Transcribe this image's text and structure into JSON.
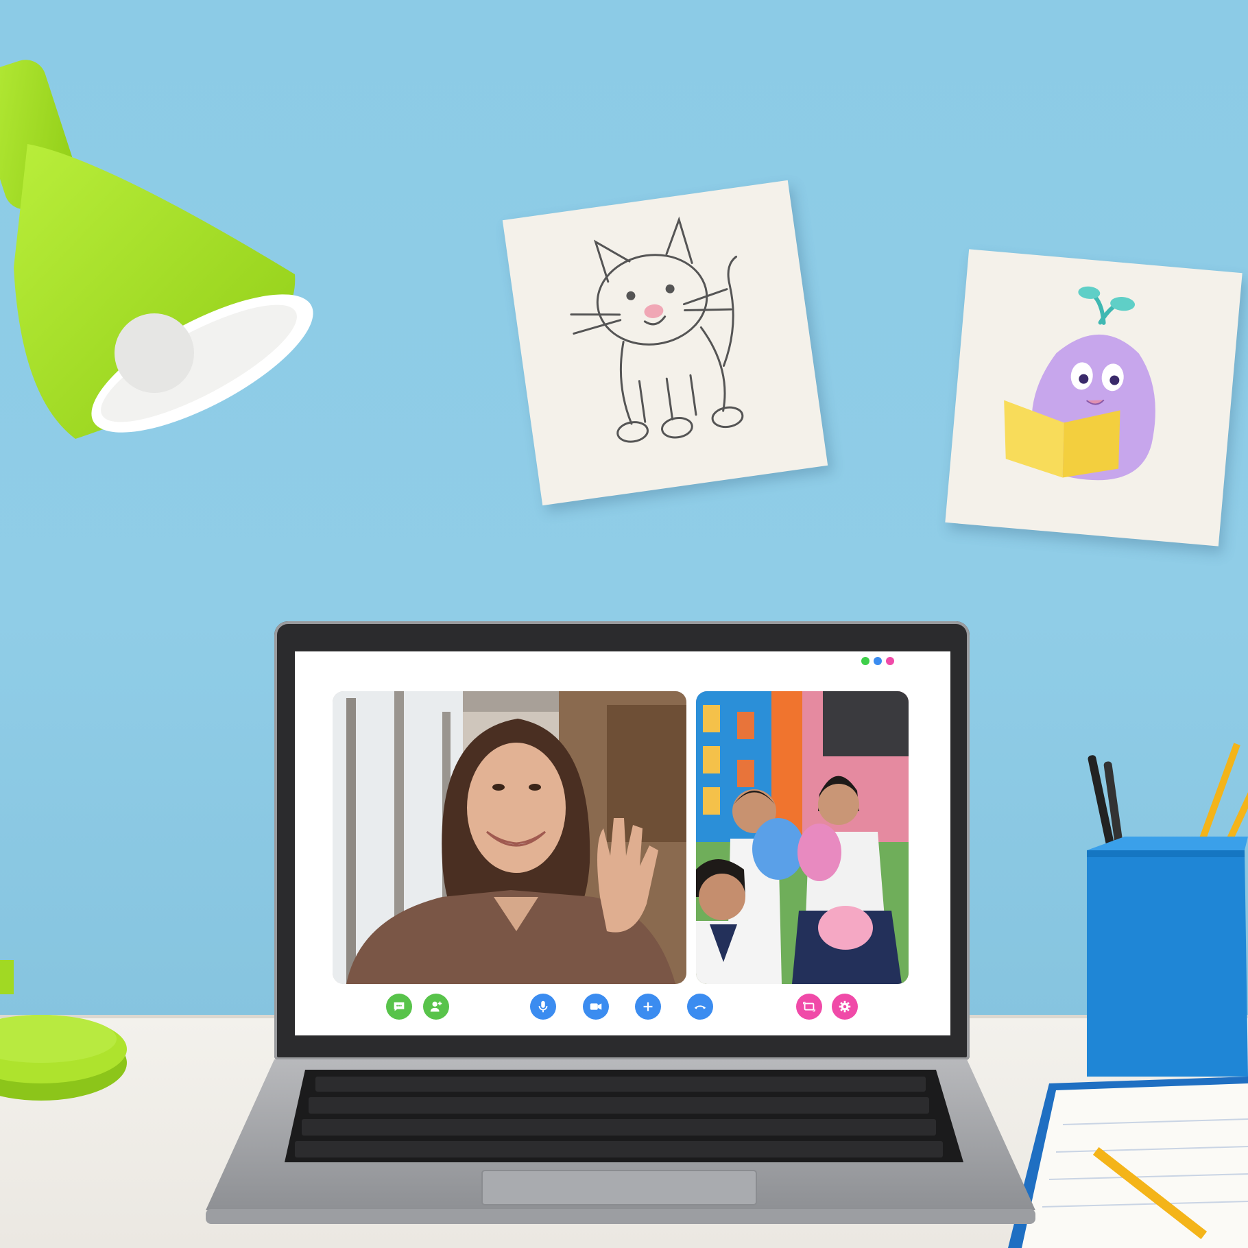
{
  "scene": {
    "wall_color": "#8fcde6",
    "desk_color": "#f0eee9",
    "lamp_color": "#a8e02a"
  },
  "drawings": [
    {
      "subject": "cat-drawing",
      "style": "pencil"
    },
    {
      "subject": "purple-creature-reading-book",
      "style": "colored-pencil"
    }
  ],
  "video_call": {
    "window_dots": [
      "#3ecf4a",
      "#3b8cf0",
      "#f04aa8"
    ],
    "participants": [
      {
        "name_icon": "teacher-video-tile"
      },
      {
        "name_icon": "students-video-tile"
      }
    ],
    "controls": {
      "left": [
        {
          "icon": "chat-icon",
          "color": "#58c34a"
        },
        {
          "icon": "add-user-icon",
          "color": "#58c34a"
        }
      ],
      "center": [
        {
          "icon": "microphone-icon",
          "color": "#3b8cf0"
        },
        {
          "icon": "video-camera-icon",
          "color": "#3b8cf0"
        },
        {
          "icon": "plus-icon",
          "color": "#3b8cf0"
        },
        {
          "icon": "hang-up-icon",
          "color": "#3b8cf0"
        }
      ],
      "right": [
        {
          "icon": "screen-share-icon",
          "color": "#f04aa8"
        },
        {
          "icon": "settings-gear-icon",
          "color": "#f04aa8"
        }
      ]
    }
  }
}
